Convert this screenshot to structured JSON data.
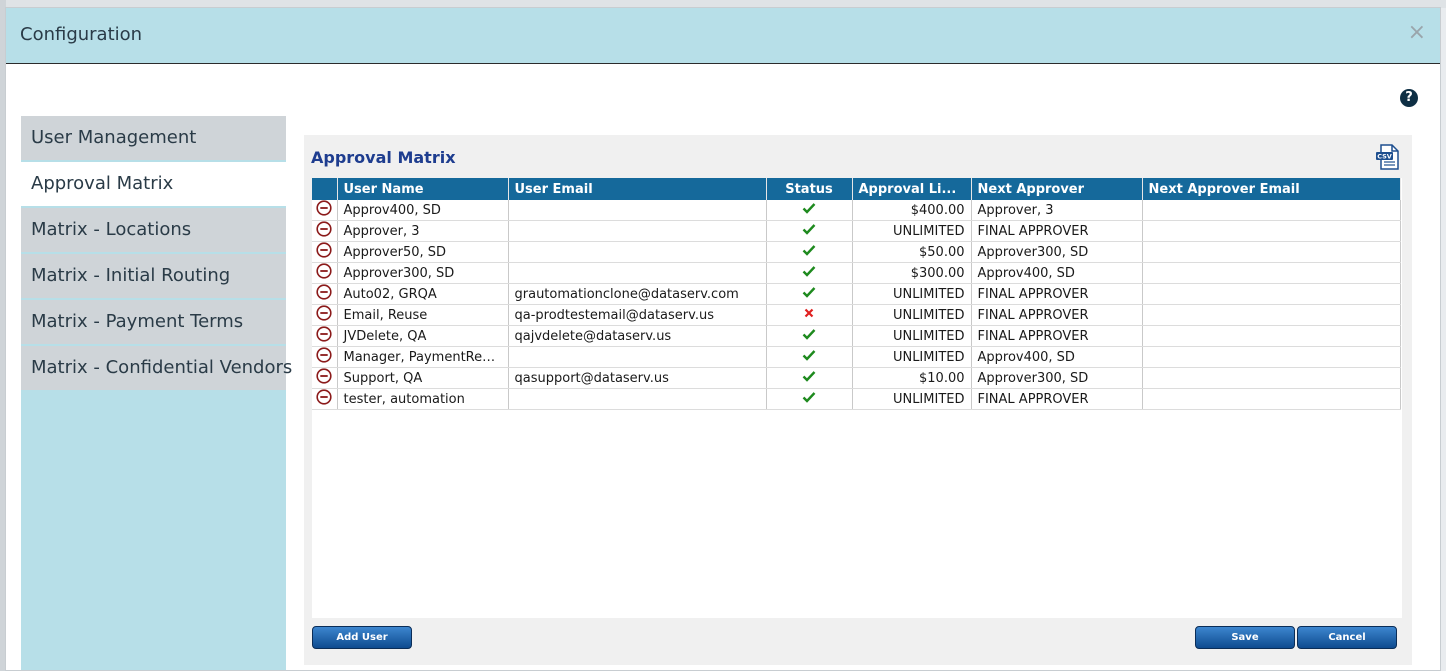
{
  "modal": {
    "title": "Configuration",
    "close_glyph": "×"
  },
  "help": {
    "glyph": "?"
  },
  "sidebar": {
    "items": [
      {
        "label": "User Management"
      },
      {
        "label": "Approval Matrix"
      },
      {
        "label": "Matrix - Locations"
      },
      {
        "label": "Matrix - Initial Routing"
      },
      {
        "label": "Matrix - Payment Terms"
      },
      {
        "label": "Matrix - Confidential Vendors"
      }
    ],
    "active_index": 1
  },
  "panel": {
    "title": "Approval Matrix",
    "csv_label": "CSV"
  },
  "table": {
    "headers": {
      "user_name": "User Name",
      "user_email": "User Email",
      "status": "Status",
      "approval_limit": "Approval Li...",
      "next_approver": "Next Approver",
      "next_approver_email": "Next Approver Email"
    },
    "rows": [
      {
        "user_name": "Approv400, SD",
        "user_email": "",
        "status": "active",
        "approval_limit": "$400.00",
        "next_approver": "Approver, 3",
        "next_approver_email": ""
      },
      {
        "user_name": "Approver, 3",
        "user_email": "",
        "status": "active",
        "approval_limit": "UNLIMITED",
        "next_approver": "FINAL APPROVER",
        "next_approver_email": ""
      },
      {
        "user_name": "Approver50, SD",
        "user_email": "",
        "status": "active",
        "approval_limit": "$50.00",
        "next_approver": "Approver300, SD",
        "next_approver_email": ""
      },
      {
        "user_name": "Approver300, SD",
        "user_email": "",
        "status": "active",
        "approval_limit": "$300.00",
        "next_approver": "Approv400, SD",
        "next_approver_email": ""
      },
      {
        "user_name": "Auto02, GRQA",
        "user_email": "grautomationclone@dataserv.com",
        "status": "active",
        "approval_limit": "UNLIMITED",
        "next_approver": "FINAL APPROVER",
        "next_approver_email": ""
      },
      {
        "user_name": "Email, Reuse",
        "user_email": "qa-prodtestemail@dataserv.us",
        "status": "inactive",
        "approval_limit": "UNLIMITED",
        "next_approver": "FINAL APPROVER",
        "next_approver_email": ""
      },
      {
        "user_name": "JVDelete, QA",
        "user_email": "qajvdelete@dataserv.us",
        "status": "active",
        "approval_limit": "UNLIMITED",
        "next_approver": "FINAL APPROVER",
        "next_approver_email": ""
      },
      {
        "user_name": "Manager, PaymentReq...",
        "user_email": "",
        "status": "active",
        "approval_limit": "UNLIMITED",
        "next_approver": "Approv400, SD",
        "next_approver_email": ""
      },
      {
        "user_name": "Support, QA",
        "user_email": "qasupport@dataserv.us",
        "status": "active",
        "approval_limit": "$10.00",
        "next_approver": "Approver300, SD",
        "next_approver_email": ""
      },
      {
        "user_name": "tester, automation",
        "user_email": "",
        "status": "active",
        "approval_limit": "UNLIMITED",
        "next_approver": "FINAL APPROVER",
        "next_approver_email": ""
      }
    ]
  },
  "buttons": {
    "add_user": "Add User",
    "save": "Save",
    "cancel": "Cancel"
  },
  "colors": {
    "header_bg": "#b7dfe8",
    "table_header": "#15699b",
    "status_active": "#1e8a1e",
    "status_inactive": "#e02020",
    "delete_icon": "#8b1a1a",
    "panel_title": "#1e3d8f"
  },
  "icons": {
    "delete": "minus-circle-icon",
    "active": "check-icon",
    "inactive": "x-icon",
    "csv": "csv-file-icon",
    "help": "question-circle-icon",
    "close": "close-icon"
  }
}
